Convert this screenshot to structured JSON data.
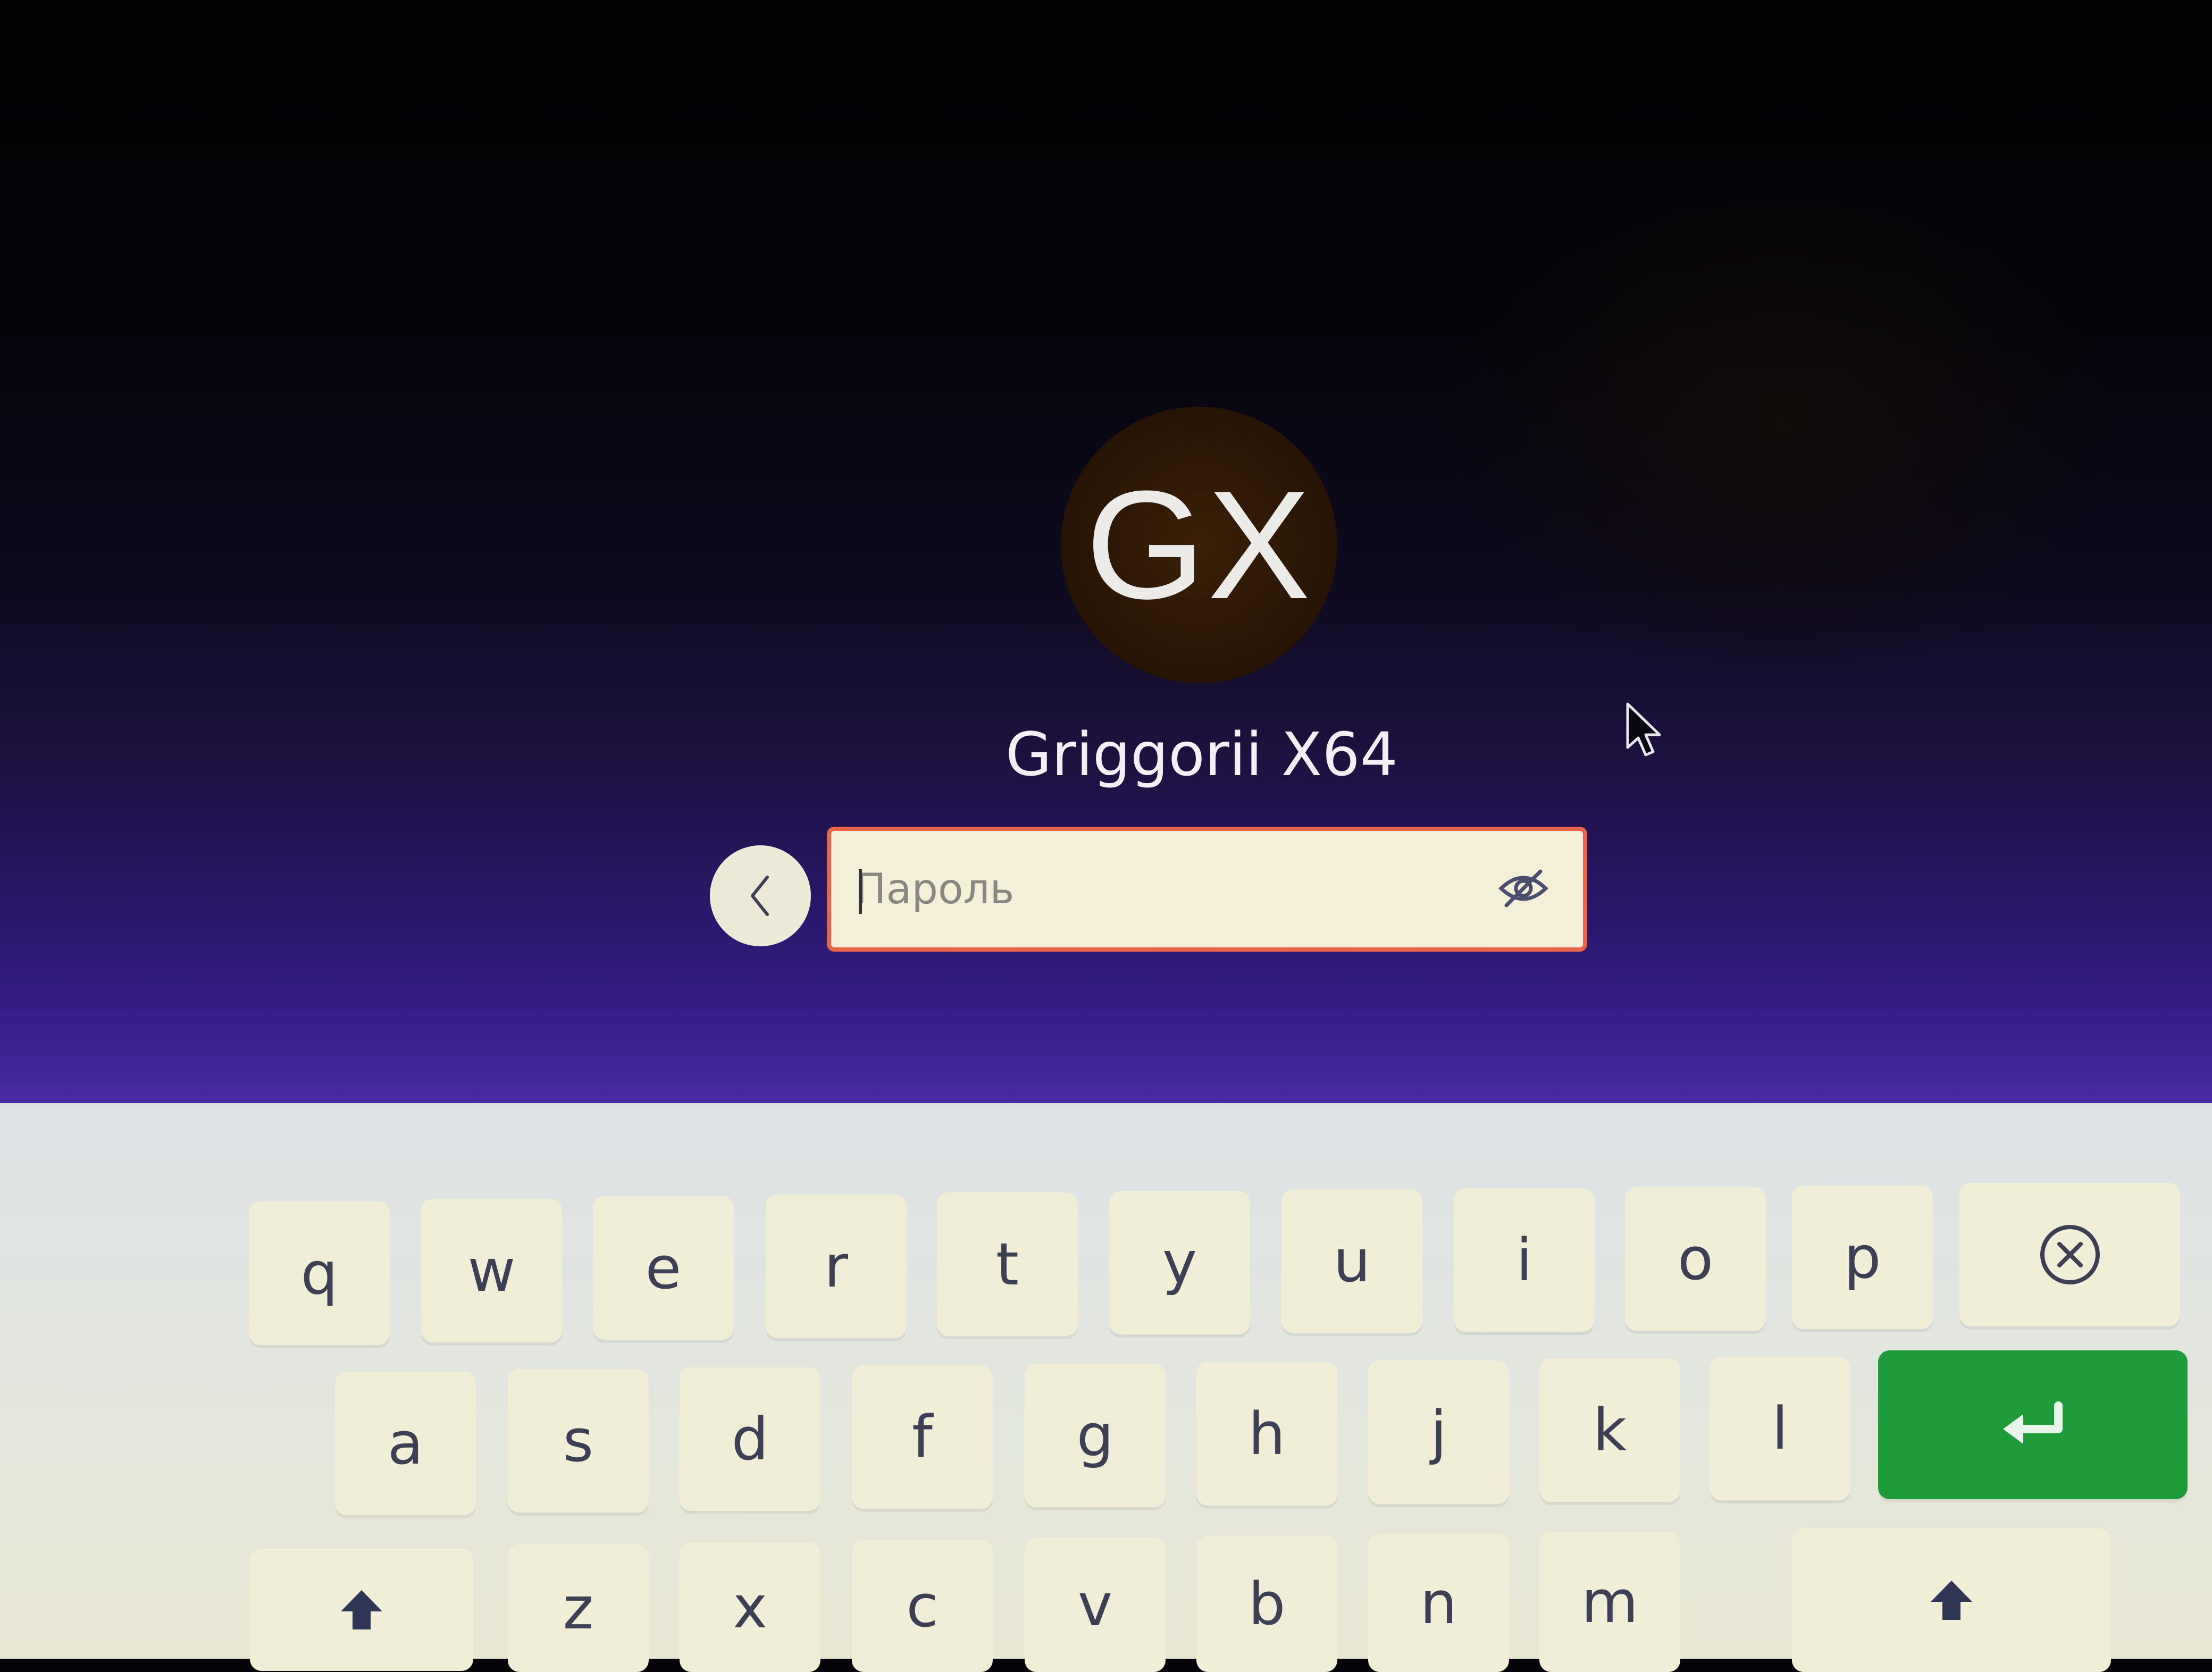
{
  "login": {
    "avatar_initials": "GX",
    "username": "Griggorii X64",
    "password_placeholder": "Пароль",
    "back_icon": "chevron-left-icon",
    "reveal_icon": "eye-slash-icon",
    "accent_border": "#e8654a"
  },
  "keyboard": {
    "row1": [
      "q",
      "w",
      "e",
      "r",
      "t",
      "y",
      "u",
      "i",
      "o",
      "p"
    ],
    "row2": [
      "a",
      "s",
      "d",
      "f",
      "g",
      "h",
      "j",
      "k",
      "l"
    ],
    "row3": [
      "z",
      "x",
      "c",
      "v",
      "b",
      "n",
      "m"
    ],
    "backspace_icon": "circle-x-icon",
    "enter_icon": "enter-arrow-icon",
    "shift_icon": "shift-up-arrow-icon",
    "enter_color": "#1e9c3a"
  }
}
